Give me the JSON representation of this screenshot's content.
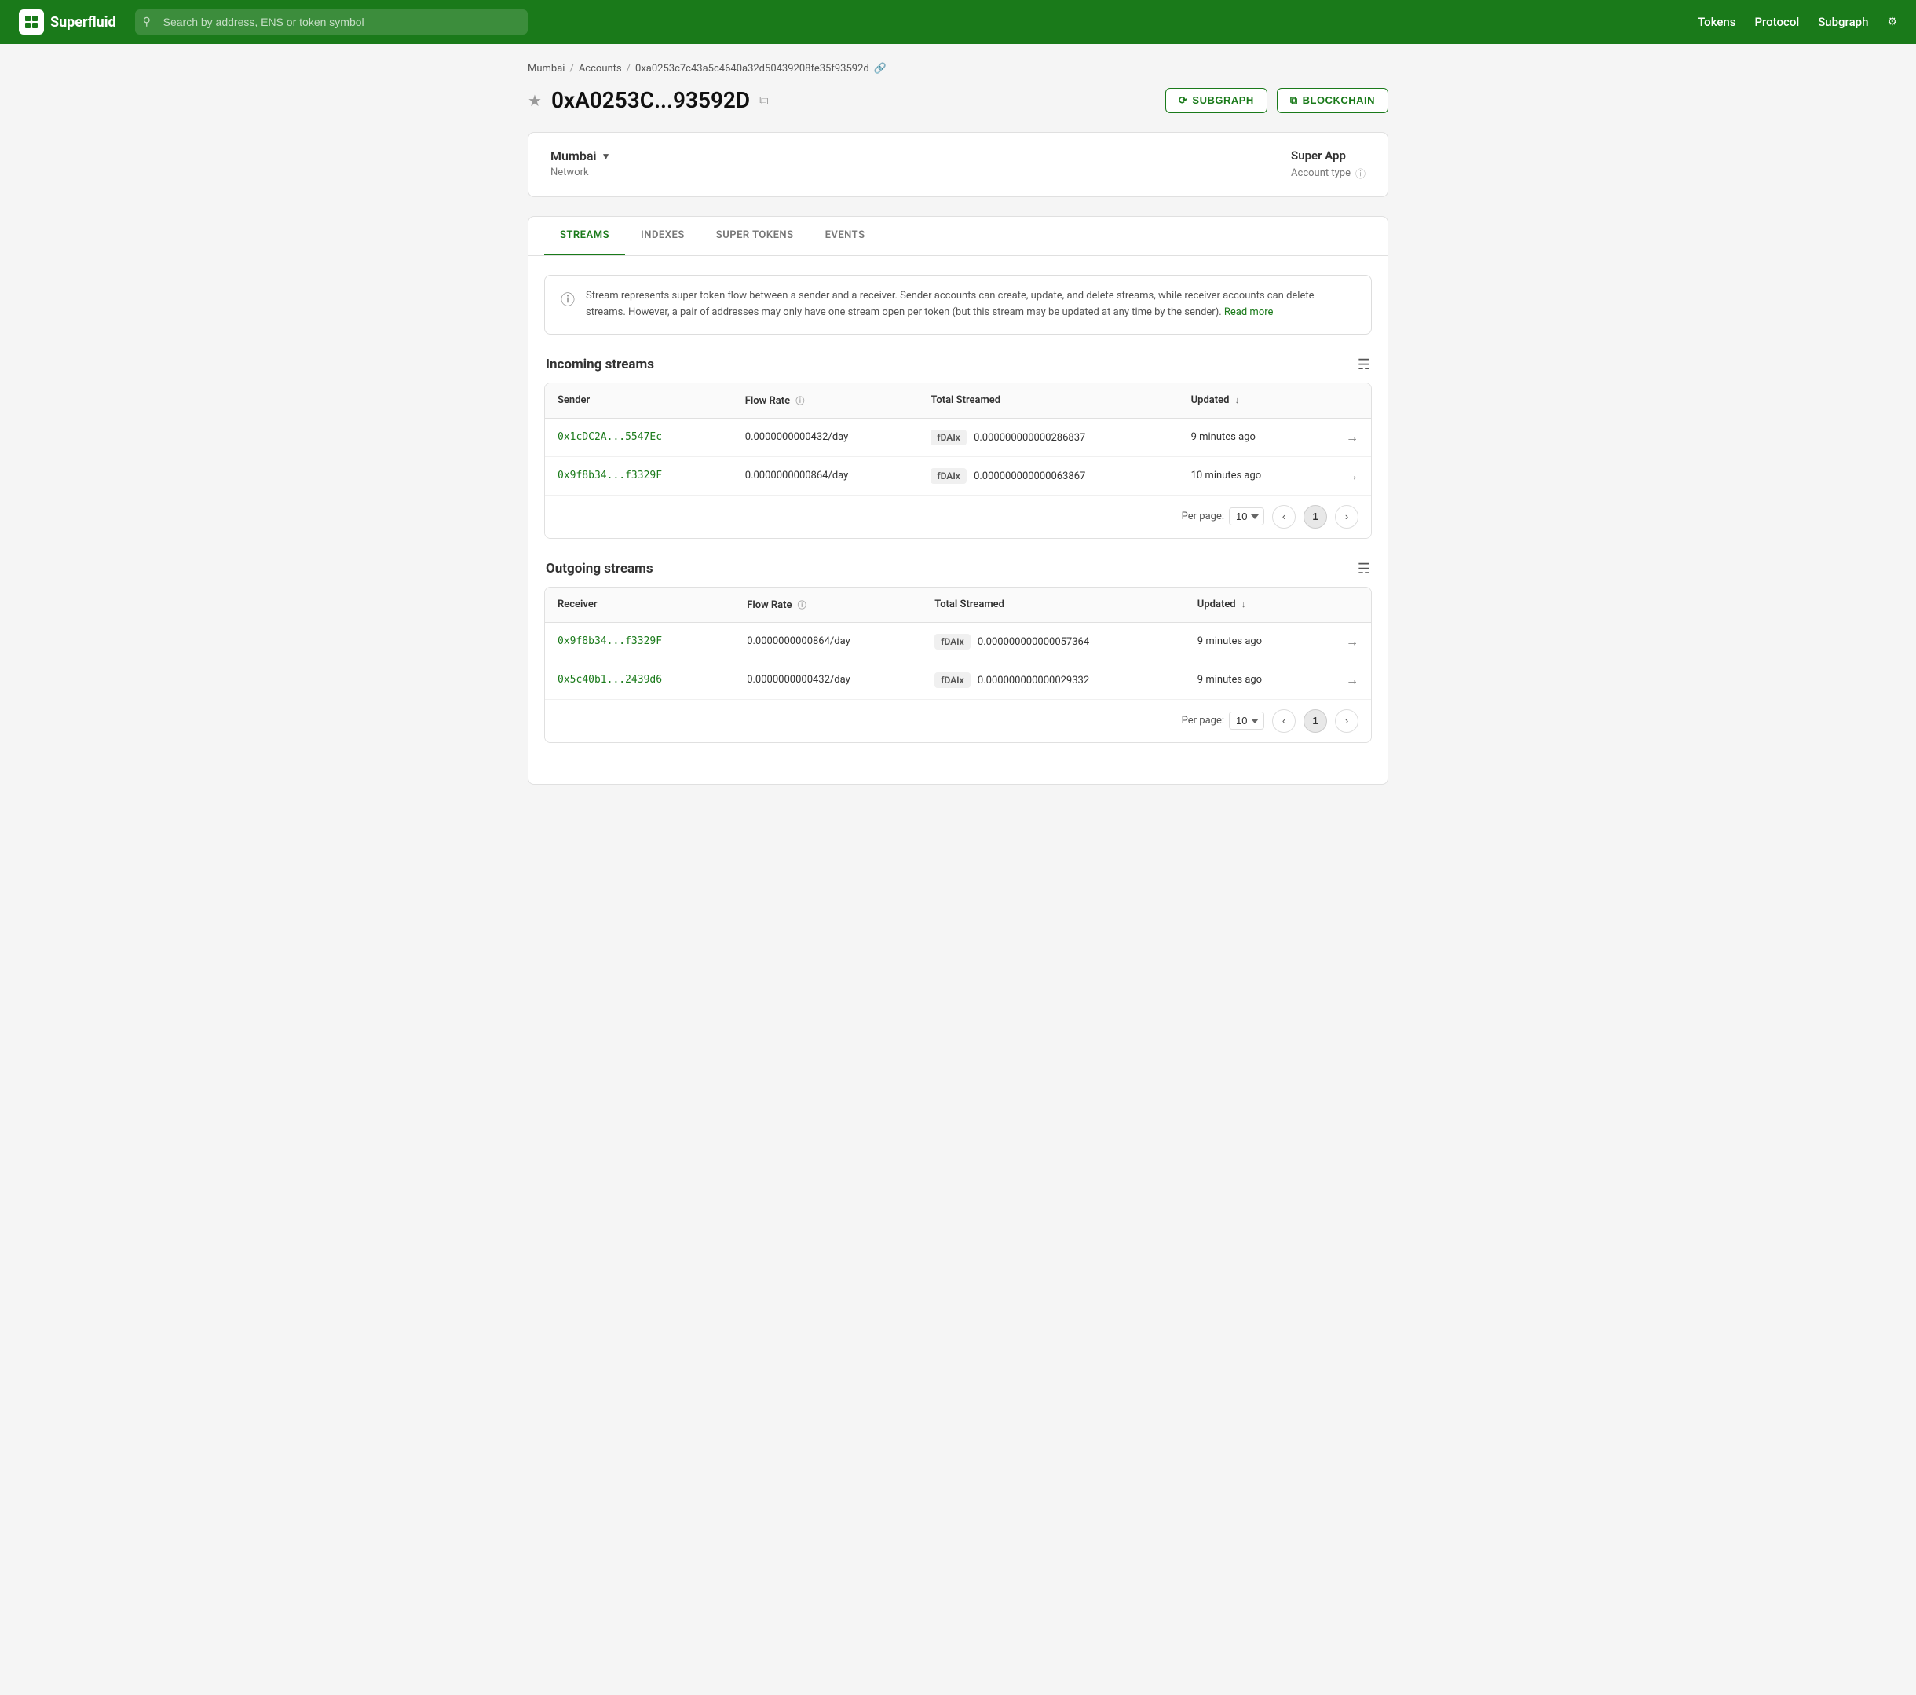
{
  "header": {
    "logo_text": "Superfluid",
    "search_placeholder": "Search by address, ENS or token symbol",
    "nav": [
      "Tokens",
      "Protocol",
      "Subgraph"
    ]
  },
  "breadcrumb": {
    "network": "Mumbai",
    "section": "Accounts",
    "address_full": "0xa0253c7c43a5c4640a32d50439208fe35f93592d"
  },
  "page_title": {
    "address_short": "0xA0253C...93592D",
    "subgraph_label": "SUBGRAPH",
    "blockchain_label": "BLOCKCHAIN"
  },
  "network_card": {
    "network_name": "Mumbai",
    "network_label": "Network",
    "account_type": "Super App",
    "account_type_label": "Account type"
  },
  "tabs": [
    "STREAMS",
    "INDEXES",
    "SUPER TOKENS",
    "EVENTS"
  ],
  "active_tab": 0,
  "info_box": {
    "text": "Stream represents super token flow between a sender and a receiver. Sender accounts can create, update, and delete streams, while receiver accounts can delete streams. However, a pair of addresses may only have one stream open per token (but this stream may be updated at any time by the sender).",
    "link_text": "Read more"
  },
  "incoming_streams": {
    "title": "Incoming streams",
    "columns": [
      "Sender",
      "Flow Rate",
      "Total Streamed",
      "Updated"
    ],
    "rows": [
      {
        "sender": "0x1cDC2A...5547Ec",
        "flow_rate": "0.0000000000432/day",
        "token": "fDAIx",
        "total_streamed": "0.000000000000286837",
        "updated": "9 minutes ago"
      },
      {
        "sender": "0x9f8b34...f3329F",
        "flow_rate": "0.0000000000864/day",
        "token": "fDAIx",
        "total_streamed": "0.000000000000063867",
        "updated": "10 minutes ago"
      }
    ],
    "per_page": "10",
    "current_page": 1
  },
  "outgoing_streams": {
    "title": "Outgoing streams",
    "columns": [
      "Receiver",
      "Flow Rate",
      "Total Streamed",
      "Updated"
    ],
    "rows": [
      {
        "receiver": "0x9f8b34...f3329F",
        "flow_rate": "0.0000000000864/day",
        "token": "fDAIx",
        "total_streamed": "0.000000000000057364",
        "updated": "9 minutes ago"
      },
      {
        "receiver": "0x5c40b1...2439d6",
        "flow_rate": "0.0000000000432/day",
        "token": "fDAIx",
        "total_streamed": "0.000000000000029332",
        "updated": "9 minutes ago"
      }
    ],
    "per_page": "10",
    "current_page": 1
  },
  "colors": {
    "brand": "#1a7a1a",
    "link": "#1a7a1a"
  }
}
